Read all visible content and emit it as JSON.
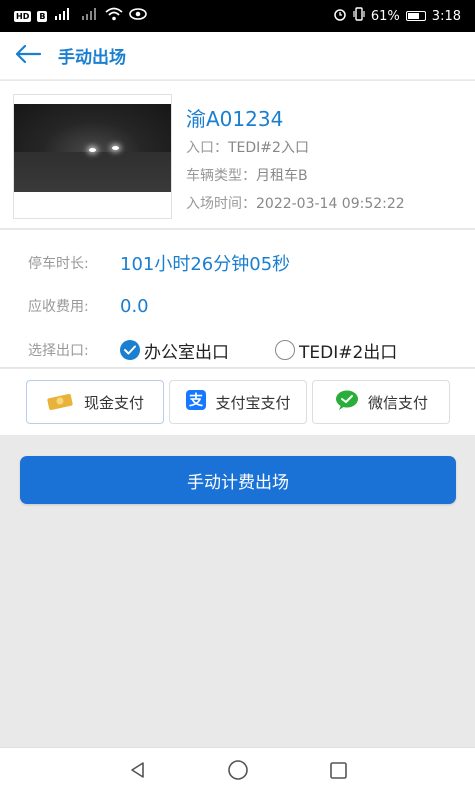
{
  "status_bar": {
    "left_badge": "HD",
    "left_badge2": "B",
    "network": "⁴ᴳ",
    "battery_pct": "61%",
    "time": "3:18"
  },
  "app_bar": {
    "title": "手动出场"
  },
  "vehicle": {
    "plate": "渝A01234",
    "entrance_label": "入口：",
    "entrance_value": "TEDI#2入口",
    "type_label": "车辆类型：",
    "type_value": "月租车B",
    "entry_time_label": "入场时间：",
    "entry_time_value": "2022-03-14 09:52:22"
  },
  "details": {
    "duration_label": "停车时长:",
    "duration_value": "101小时26分钟05秒",
    "fee_label": "应收费用:",
    "fee_value": "0.0",
    "exit_label": "选择出口:",
    "exits": [
      {
        "label": "办公室出口",
        "selected": true
      },
      {
        "label": "TEDI#2出口",
        "selected": false
      }
    ]
  },
  "payment": {
    "cash": "现金支付",
    "alipay": "支付宝支付",
    "wechat": "微信支付"
  },
  "action": {
    "main_button": "手动计费出场"
  },
  "colors": {
    "accent": "#1a7fd0",
    "button": "#1a72d6",
    "wechat": "#2aae3a",
    "alipay": "#1677ff",
    "cash": "#e8b33a"
  }
}
